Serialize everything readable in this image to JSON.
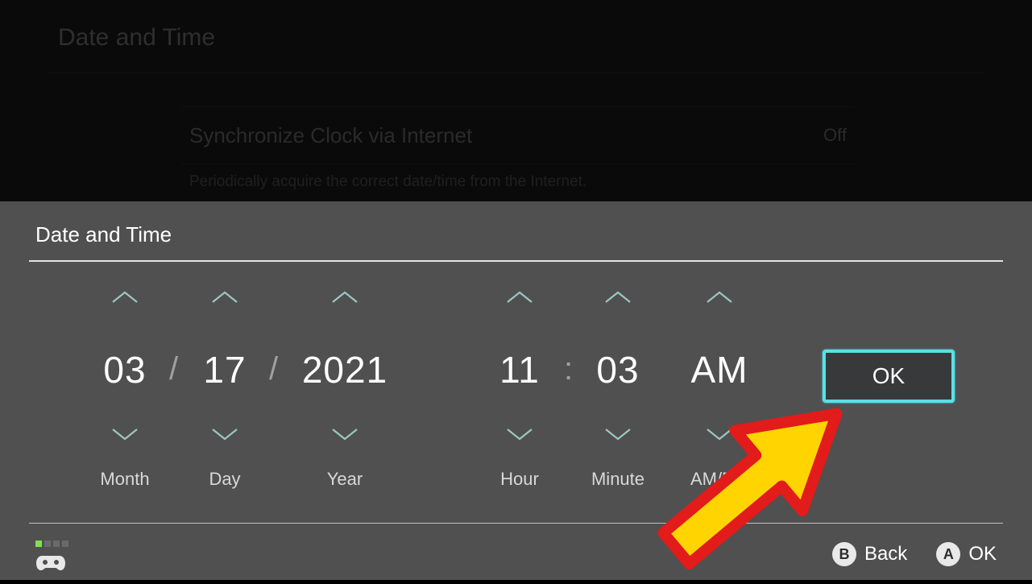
{
  "page": {
    "title": "Date and Time",
    "sync_row": {
      "label": "Synchronize Clock via Internet",
      "value": "Off"
    },
    "sync_help": "Periodically acquire the correct date/time from the Internet."
  },
  "dialog": {
    "title": "Date and Time",
    "ok_label": "OK",
    "fields": {
      "month": {
        "value": "03",
        "label": "Month"
      },
      "day": {
        "value": "17",
        "label": "Day"
      },
      "year": {
        "value": "2021",
        "label": "Year"
      },
      "hour": {
        "value": "11",
        "label": "Hour"
      },
      "minute": {
        "value": "03",
        "label": "Minute"
      },
      "ampm": {
        "value": "AM",
        "label": "AM/PM"
      }
    },
    "sep_date": "/",
    "sep_time": ":"
  },
  "footer": {
    "hints": {
      "back": "Back",
      "ok": "OK",
      "back_btn": "B",
      "ok_btn": "A"
    }
  },
  "colors": {
    "accent": "#58e1e6",
    "chevron": "#9cc8c0"
  }
}
